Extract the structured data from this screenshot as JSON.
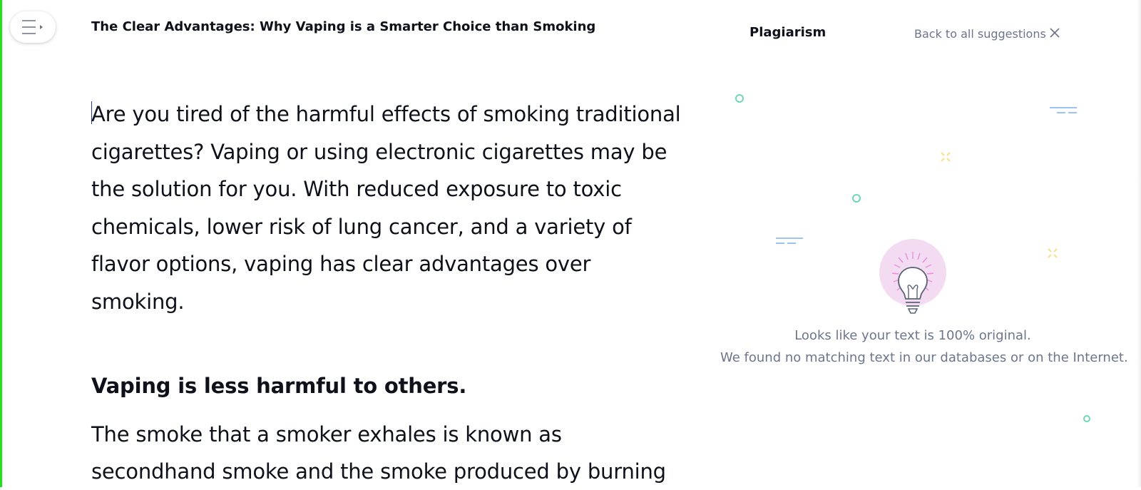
{
  "document": {
    "title": "The Clear Advantages: Why Vaping is a Smarter Choice than Smoking",
    "intro_lines": [
      "Are you tired of the harmful effects of smoking traditional",
      "cigarettes? Vaping or using electronic cigarettes may be",
      "the solution for you. With reduced exposure to toxic",
      "chemicals, lower risk of lung cancer, and a variety of",
      "flavor options, vaping has clear advantages over",
      "smoking."
    ],
    "heading": "Vaping is less harmful to others.",
    "section_lines": [
      "The smoke that a smoker exhales is known as",
      "secondhand smoke and the smoke produced by burning"
    ]
  },
  "sidebar_panel": {
    "title": "Plagiarism",
    "back_label": "Back to all suggestions",
    "close_icon": "close-icon",
    "result_line1": "Looks like your text is 100% original.",
    "result_line2": "We found no matching text in our databases or on the Internet."
  },
  "colors": {
    "accent_green": "#22e01a",
    "text": "#0e101a",
    "muted": "#6d758d",
    "bulb_bg": "#f3dcf2",
    "teal": "#6fd6b8",
    "blue": "#9cc3f5",
    "yellow": "#f7e08a"
  },
  "icons": {
    "menu": "menu-expand-icon",
    "bulb": "lightbulb-icon"
  }
}
